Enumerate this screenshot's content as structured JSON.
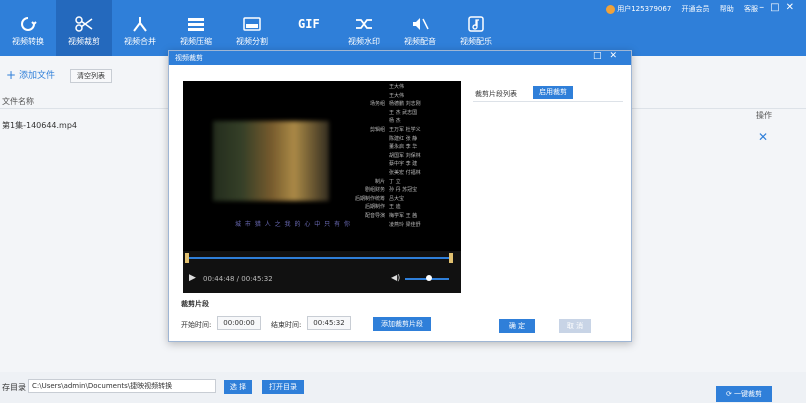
{
  "toolbar": {
    "items": [
      {
        "label": "视频转换",
        "icon": "convert-icon"
      },
      {
        "label": "视频裁剪",
        "icon": "scissors-icon"
      },
      {
        "label": "视频合并",
        "icon": "merge-icon"
      },
      {
        "label": "视频压缩",
        "icon": "compress-icon"
      },
      {
        "label": "视频分割",
        "icon": "split-icon"
      },
      {
        "label": "GIF",
        "icon": "gif-icon"
      },
      {
        "label": "视频水印",
        "icon": "shuffle-icon"
      },
      {
        "label": "视频配音",
        "icon": "mute-icon"
      },
      {
        "label": "视频配乐",
        "icon": "music-icon"
      }
    ],
    "user": "用户125379067",
    "links": [
      "开通会员",
      "帮助",
      "客服"
    ]
  },
  "main": {
    "add_file": "添加文件",
    "clear_list": "清空列表",
    "col_filename": "文件名称",
    "col_action": "操作",
    "file": "第1集-140644.mp4"
  },
  "bottom": {
    "output_label": "存目录",
    "output_path": "C:\\Users\\admin\\Documents\\捷映视频转换",
    "browse": "选 择",
    "open_dir": "打开目录",
    "one_click": "一键裁剪"
  },
  "dialog": {
    "title": "视频裁剪",
    "seglist_label": "裁剪片段列表",
    "enable_btn": "启用裁剪",
    "clip_title": "裁剪片段",
    "start_label": "开始时间:",
    "start_value": "00:00:00",
    "end_label": "结束时间:",
    "end_value": "00:45:32",
    "add_segment": "添加裁剪片段",
    "ok": "确 定",
    "cancel": "取 消",
    "player": {
      "timecode": "00:44:48 / 00:45:32",
      "subtitle": "城 市 猎 人 之 我 的 心 中 只 有 你",
      "progress_fraction": 0.984,
      "volume_fraction": 0.55
    },
    "credits": [
      [
        "",
        "王大伟"
      ],
      [
        "",
        "王大伟"
      ],
      [
        "场务组",
        "杨德鹏  刘志刚"
      ],
      [
        "",
        "王  杰  武志国"
      ],
      [
        "",
        "杨  杰"
      ],
      [
        "剪辑组",
        "王万军  杜学义"
      ],
      [
        "",
        "陈建红  张  静"
      ],
      [
        "",
        "董永启  李  华"
      ],
      [
        "",
        "胡国军  刘保林"
      ],
      [
        "",
        "蔡中宇  李  建"
      ],
      [
        "",
        "张美宏  付福林"
      ],
      [
        "制片",
        "丁  立"
      ],
      [
        "剧组财务",
        "孙  丹  苏冠宝"
      ],
      [
        "后期制作统筹",
        "吕大宝"
      ],
      [
        "后期制作",
        "王  迪"
      ],
      [
        "配音导演",
        "梅学军  王  茜"
      ],
      [
        "",
        "凌燕玲  梁佳舒"
      ]
    ]
  },
  "colors": {
    "accent": "#2f7fd9",
    "toolbar_active": "#2469bd"
  }
}
